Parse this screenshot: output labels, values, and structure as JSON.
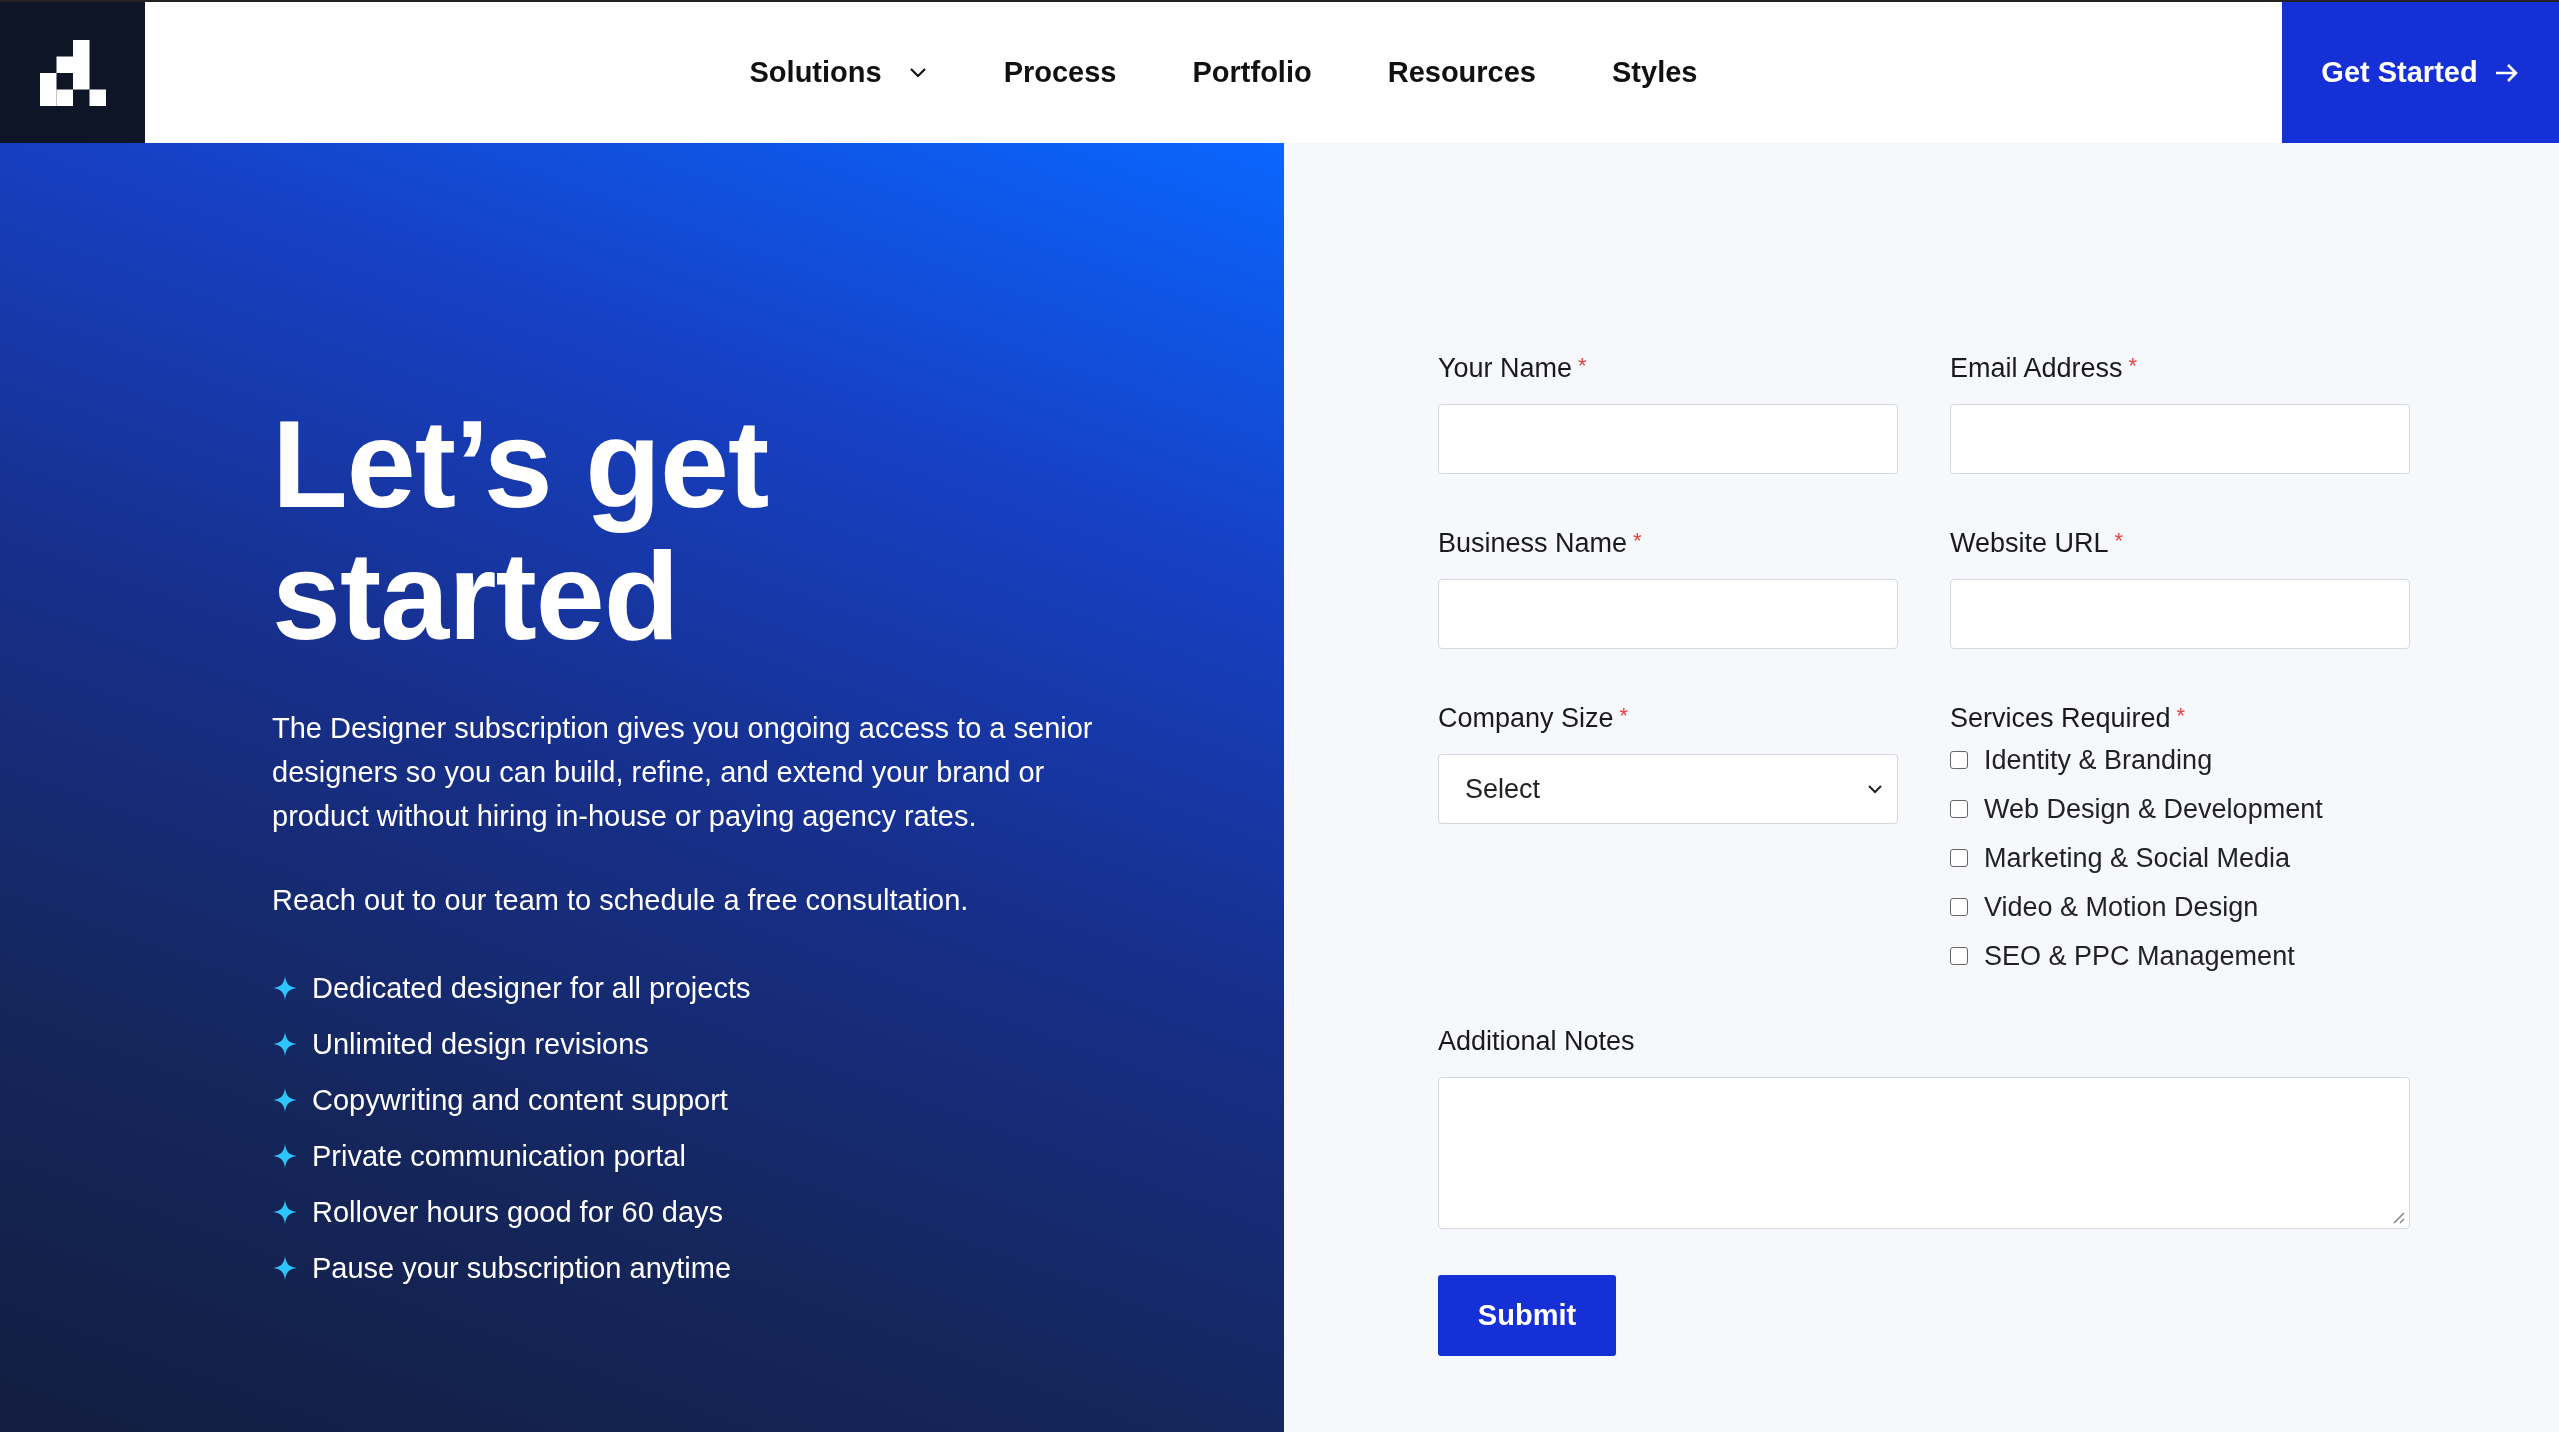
{
  "header": {
    "nav": [
      {
        "label": "Solutions",
        "dropdown": true
      },
      {
        "label": "Process",
        "dropdown": false
      },
      {
        "label": "Portfolio",
        "dropdown": false
      },
      {
        "label": "Resources",
        "dropdown": false
      },
      {
        "label": "Styles",
        "dropdown": false
      }
    ],
    "cta": {
      "label": "Get Started"
    }
  },
  "hero": {
    "title_lines": [
      "Let’s get",
      "started"
    ],
    "paragraphs": [
      "The Designer subscription gives you ongoing access to a senior designers so you can build, refine, and extend your brand or product without hiring in-house or paying agency rates.",
      "Reach out to our team to schedule a free consultation."
    ],
    "benefits": [
      "Dedicated designer for all projects",
      "Unlimited design revisions",
      "Copywriting and content support",
      "Private communication portal",
      "Rollover hours good for 60 days",
      "Pause your subscription anytime"
    ]
  },
  "form": {
    "fields": [
      {
        "kind": "text",
        "label": "Your Name",
        "required_mark": "*"
      },
      {
        "kind": "text",
        "label": "Email Address",
        "required_mark": "*"
      },
      {
        "kind": "text",
        "label": "Business Name",
        "required_mark": "*"
      },
      {
        "kind": "text",
        "label": "Website URL",
        "required_mark": "*"
      },
      {
        "kind": "select",
        "label": "Company Size",
        "required_mark": "*",
        "value": "Select"
      },
      {
        "kind": "checkboxes",
        "label": "Services Required",
        "required_mark": "*",
        "options": [
          {
            "label": "Identity & Branding",
            "checked": false
          },
          {
            "label": "Web Design & Development",
            "checked": false
          },
          {
            "label": "Marketing & Social Media",
            "checked": false
          },
          {
            "label": "Video & Motion Design",
            "checked": false
          },
          {
            "label": "SEO & PPC Management",
            "checked": false
          }
        ]
      },
      {
        "kind": "textarea",
        "label": "Additional Notes"
      }
    ],
    "submit": "Submit"
  }
}
